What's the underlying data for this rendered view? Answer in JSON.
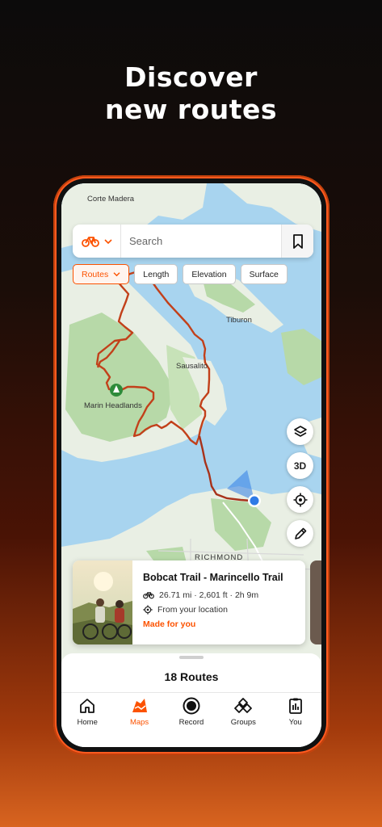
{
  "headline": {
    "line1": "Discover",
    "line2": "new routes"
  },
  "map": {
    "labels": {
      "corte_madera": "Corte Madera",
      "tiburon": "Tiburon",
      "sausalito": "Sausalito",
      "marin_headlands": "Marin Headlands",
      "richmond": "RICHMOND"
    },
    "route_color": "#c2401a",
    "water_color": "#a8d4ef",
    "land_color": "#e9efe4",
    "park_color": "#b7d9a8"
  },
  "search": {
    "sport_icon": "bike-icon",
    "placeholder": "Search",
    "bookmark_icon": "bookmark-icon"
  },
  "filters": {
    "routes": "Routes",
    "length": "Length",
    "elevation": "Elevation",
    "surface": "Surface"
  },
  "map_controls": {
    "layers_icon": "layers-icon",
    "three_d": "3D",
    "locate_icon": "locate-icon",
    "draw_icon": "pencil-icon"
  },
  "route_card": {
    "title": "Bobcat Trail - Marincello Trail",
    "stats": "26.71 mi · 2,601 ft · 2h 9m",
    "location": "From your location",
    "tag": "Made for you"
  },
  "sheet": {
    "title": "18 Routes"
  },
  "tabs": [
    {
      "label": "Home",
      "icon": "home-icon"
    },
    {
      "label": "Maps",
      "icon": "maps-icon"
    },
    {
      "label": "Record",
      "icon": "record-icon"
    },
    {
      "label": "Groups",
      "icon": "groups-icon"
    },
    {
      "label": "You",
      "icon": "clipboard-icon"
    }
  ],
  "colors": {
    "accent": "#fc5200",
    "phone_frame": "#ff5a1f"
  }
}
